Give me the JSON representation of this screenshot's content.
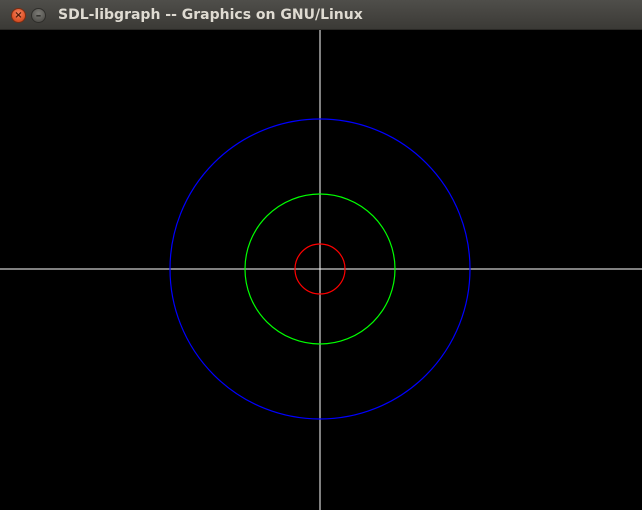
{
  "window": {
    "title": "SDL-libgraph -- Graphics on GNU/Linux",
    "close_glyph": "×",
    "minimize_glyph": "–",
    "close_icon": "close-icon",
    "minimize_icon": "minimize-icon"
  },
  "canvas": {
    "background": "#000000",
    "axes_color": "#ffffff",
    "circles": [
      {
        "name": "outer-circle",
        "color": "#0000ff"
      },
      {
        "name": "middle-circle",
        "color": "#00ff00"
      },
      {
        "name": "inner-circle",
        "color": "#ff0000"
      }
    ]
  }
}
